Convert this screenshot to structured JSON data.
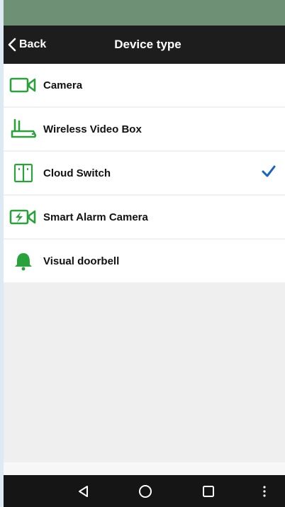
{
  "nav": {
    "back_label": "Back",
    "title": "Device type"
  },
  "devices": [
    {
      "label": "Camera",
      "icon": "camera-icon",
      "selected": false
    },
    {
      "label": "Wireless Video Box",
      "icon": "router-icon",
      "selected": false
    },
    {
      "label": "Cloud Switch",
      "icon": "switch-icon",
      "selected": true
    },
    {
      "label": "Smart Alarm Camera",
      "icon": "alarm-camera-icon",
      "selected": false
    },
    {
      "label": "Visual doorbell",
      "icon": "bell-icon",
      "selected": false
    }
  ],
  "colors": {
    "accent_green": "#2aa23c",
    "check_blue": "#1565c0",
    "status_bar": "#6e9074",
    "nav_bar": "#1d1d1d"
  },
  "system_nav": [
    "back-triangle-icon",
    "home-circle-icon",
    "recents-square-icon",
    "more-dots-icon"
  ]
}
